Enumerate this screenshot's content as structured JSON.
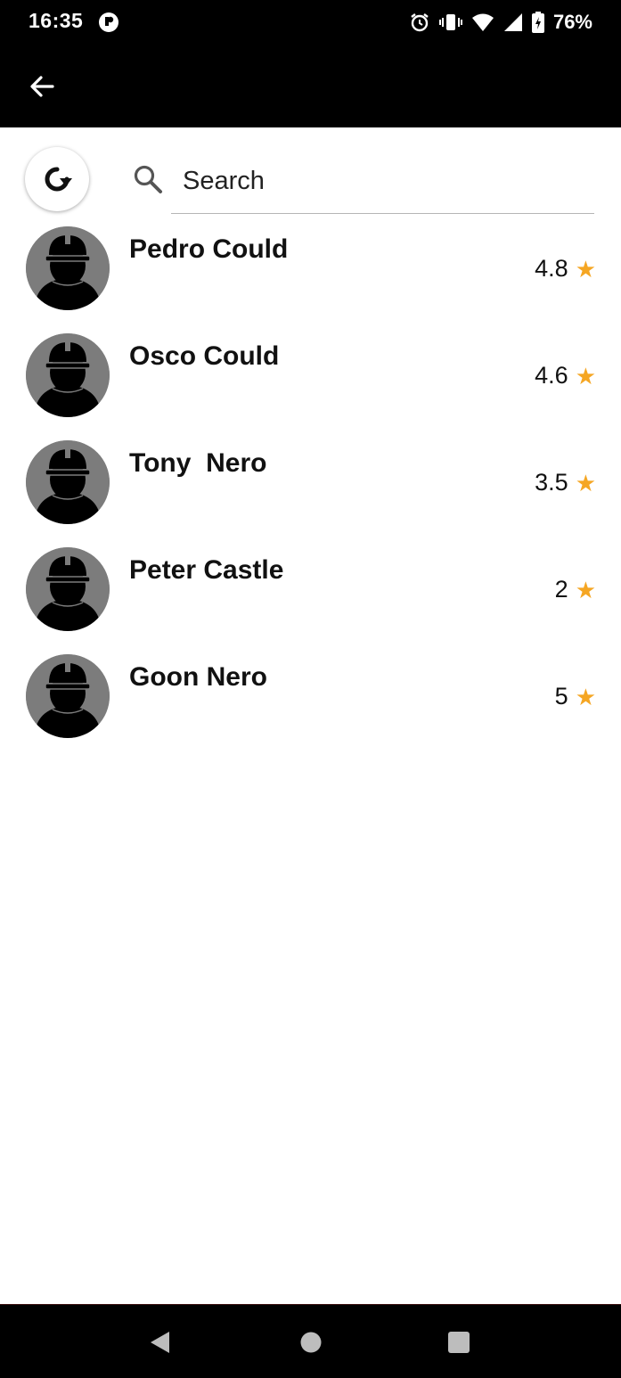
{
  "status_bar": {
    "time": "16:35",
    "battery": "76%",
    "icons": [
      "notification-icon",
      "alarm-icon",
      "vibrate-icon",
      "wifi-icon",
      "signal-icon",
      "battery-icon"
    ]
  },
  "app_bar": {
    "back_icon": "arrow-left-icon"
  },
  "search": {
    "placeholder": "Search",
    "value": ""
  },
  "colors": {
    "star": "#f5a623",
    "bar_background": "#000000",
    "avatar_background": "#7c7c7c"
  },
  "workers": [
    {
      "name": "Pedro Could",
      "rating": "4.8"
    },
    {
      "name": "Osco Could",
      "rating": "4.6"
    },
    {
      "name": "Tony  Nero",
      "rating": "3.5"
    },
    {
      "name": "Peter Castle",
      "rating": "2"
    },
    {
      "name": "Goon Nero",
      "rating": "5"
    }
  ],
  "nav_bar": {
    "buttons": [
      "back-triangle-icon",
      "home-circle-icon",
      "recents-square-icon"
    ]
  }
}
